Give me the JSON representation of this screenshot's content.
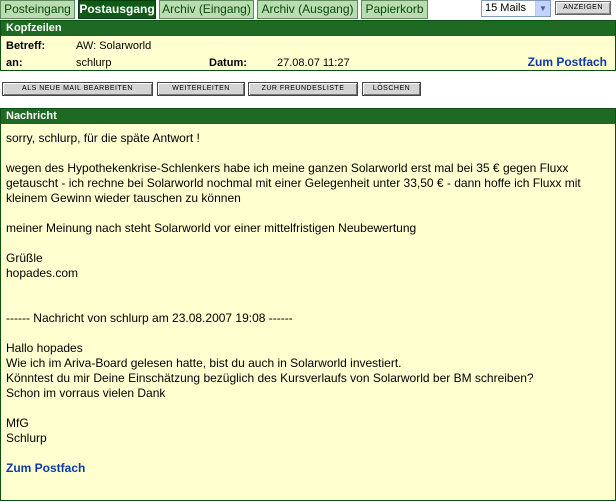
{
  "tabs": [
    "Posteingang",
    "Postausgang",
    "Archiv (Eingang)",
    "Archiv (Ausgang)",
    "Papierkorb"
  ],
  "active_tab": "Postausgang",
  "mails_select": {
    "value": "15 Mails"
  },
  "show_button": "ANZEIGEN",
  "header": {
    "title": "Kopfzeilen",
    "subject_label": "Betreff:",
    "subject": "AW: Solarworld",
    "to_label": "an:",
    "to": "schlurp",
    "date_label": "Datum:",
    "date": "27.08.07 11:27",
    "postfach_link": "Zum Postfach"
  },
  "actions": [
    "ALS NEUE MAIL BEARBEITEN",
    "WEITERLEITEN",
    "ZUR FREUNDESLISTE",
    "LÖSCHEN"
  ],
  "message": {
    "title": "Nachricht",
    "lines": [
      "sorry, schlurp, für die späte Antwort !",
      "",
      "wegen des Hypothekenkrise-Schlenkers habe ich meine ganzen Solarworld erst mal bei 35 € gegen Fluxx",
      "getauscht - ich rechne bei Solarworld nochmal mit einer Gelegenheit unter 33,50 € - dann hoffe ich Fluxx mit",
      "kleinem Gewinn wieder tauschen zu können",
      "",
      "meiner Meinung nach steht Solarworld vor einer mittelfristigen Neubewertung",
      "",
      "Grüßle",
      "hopades.com",
      "",
      "",
      "------ Nachricht von schlurp am 23.08.2007 19:08 ------",
      "",
      "Hallo hopades",
      "Wie ich im Ariva-Board gelesen hatte, bist du auch in Solarworld investiert.",
      "Könntest du mir Deine Einschätzung bezüglich des Kursverlaufs von Solarworld ber BM schreiben?",
      "Schon im vorraus vielen Dank",
      "",
      "MfG",
      "Schlurp"
    ],
    "postfach_link": "Zum Postfach"
  }
}
